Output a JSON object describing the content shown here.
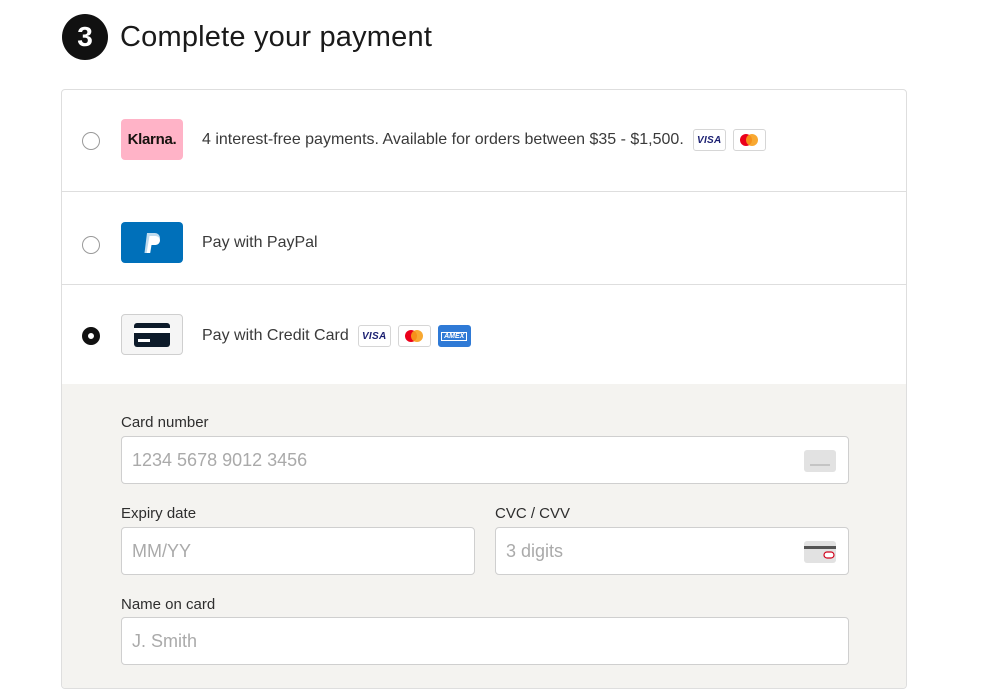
{
  "step": {
    "number": "3",
    "title": "Complete your payment"
  },
  "options": {
    "klarna": {
      "logo_text": "Klarna.",
      "description": "4 interest-free payments. Available for orders between $35 - $1,500.",
      "brands": [
        "visa",
        "mastercard"
      ],
      "selected": false
    },
    "paypal": {
      "logo_text": "P",
      "description": "Pay with PayPal",
      "selected": false
    },
    "card": {
      "description": "Pay with Credit Card",
      "brands": [
        "visa",
        "mastercard",
        "amex"
      ],
      "selected": true
    }
  },
  "brand_labels": {
    "visa": "VISA",
    "amex": "AMEX"
  },
  "form": {
    "card_number": {
      "label": "Card number",
      "placeholder": "1234 5678 9012 3456",
      "value": ""
    },
    "expiry": {
      "label": "Expiry date",
      "placeholder": "MM/YY",
      "value": ""
    },
    "cvc": {
      "label": "CVC / CVV",
      "placeholder": "3 digits",
      "value": ""
    },
    "name": {
      "label": "Name on card",
      "placeholder": "J. Smith",
      "value": ""
    }
  },
  "colors": {
    "klarna_pink": "#ffb3c7",
    "paypal_blue": "#0070ba",
    "form_background": "#f4f3f0",
    "mastercard_red": "#eb001b",
    "mastercard_orange": "#f79e1b"
  }
}
